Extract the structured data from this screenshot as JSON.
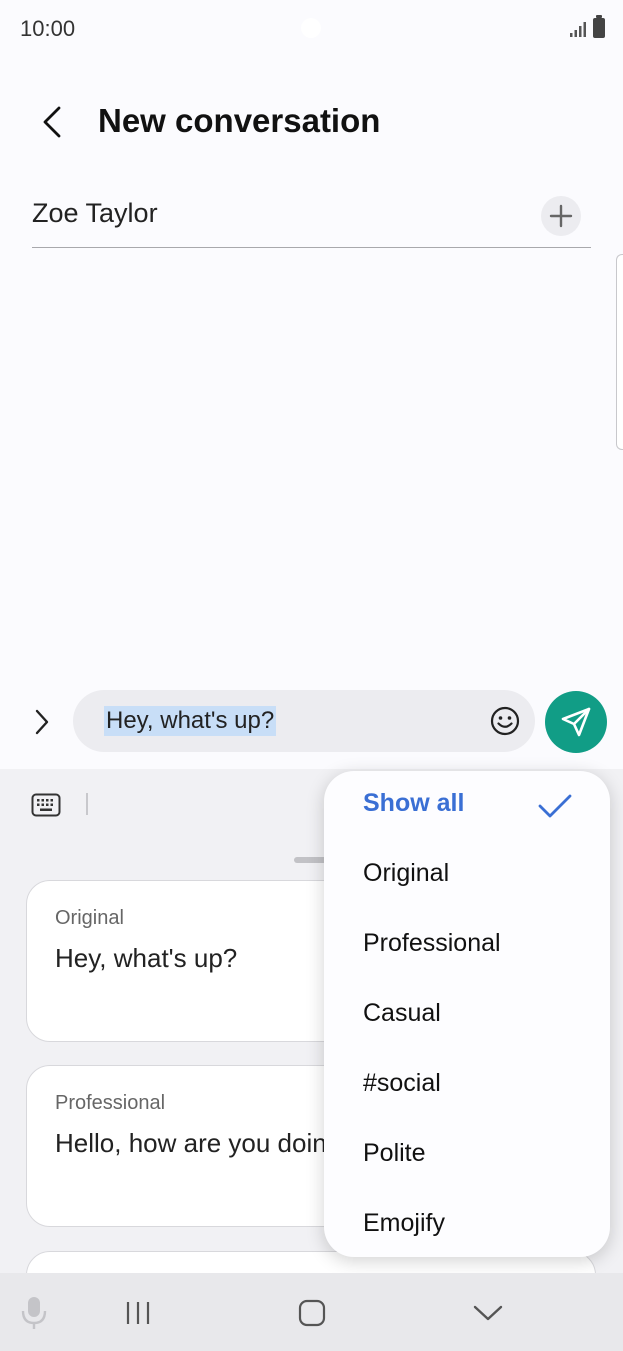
{
  "status_bar": {
    "time": "10:00"
  },
  "header": {
    "title": "New conversation"
  },
  "recipient": {
    "value": "Zoe Taylor"
  },
  "composer": {
    "message": "Hey, what's up?"
  },
  "suggestions": [
    {
      "label": "Original",
      "text": "Hey, what's up?"
    },
    {
      "label": "Professional",
      "text": "Hello, how are you doing today?"
    },
    {
      "label": "",
      "text": ""
    }
  ],
  "tone_menu": {
    "items": [
      "Show all",
      "Original",
      "Professional",
      "Casual",
      "#social",
      "Polite",
      "Emojify"
    ],
    "selected": "Show all"
  },
  "colors": {
    "accent": "#3a6fd4",
    "send_button": "#119d86",
    "selection_highlight": "#c8def7"
  },
  "icons": [
    "signal-icon",
    "battery-icon",
    "back-arrow-icon",
    "plus-icon",
    "chevron-right-icon",
    "emoji-icon",
    "send-icon",
    "keyboard-icon",
    "check-icon",
    "microphone-icon",
    "recent-apps-icon",
    "home-icon",
    "hide-keyboard-icon"
  ]
}
